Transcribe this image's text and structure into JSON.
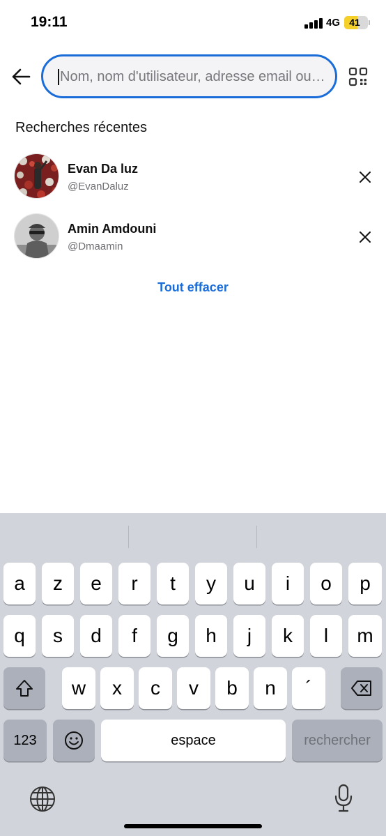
{
  "status_bar": {
    "time": "19:11",
    "network": "4G",
    "battery": "41"
  },
  "header": {
    "back_icon": "arrow-left-icon",
    "search": {
      "placeholder": "Nom, nom d'utilisateur, adresse email ou numéro",
      "value": ""
    },
    "qr_icon": "qr-code-icon",
    "accent_color": "#1a6dd8"
  },
  "recent": {
    "title": "Recherches récentes",
    "items": [
      {
        "name": "Evan Da luz",
        "handle": "@EvanDaluz",
        "remove_icon": "close-icon"
      },
      {
        "name": "Amin Amdouni",
        "handle": "@Dmaamin",
        "remove_icon": "close-icon"
      }
    ],
    "clear_all": "Tout effacer"
  },
  "keyboard": {
    "row1": [
      "a",
      "z",
      "e",
      "r",
      "t",
      "y",
      "u",
      "i",
      "o",
      "p"
    ],
    "row2": [
      "q",
      "s",
      "d",
      "f",
      "g",
      "h",
      "j",
      "k",
      "l",
      "m"
    ],
    "row3": [
      "w",
      "x",
      "c",
      "v",
      "b",
      "n",
      "´"
    ],
    "shift_icon": "shift-icon",
    "delete_icon": "backspace-icon",
    "numbers": "123",
    "emoji_icon": "emoji-icon",
    "space": "espace",
    "search": "rechercher",
    "globe_icon": "globe-icon",
    "mic_icon": "microphone-icon"
  }
}
